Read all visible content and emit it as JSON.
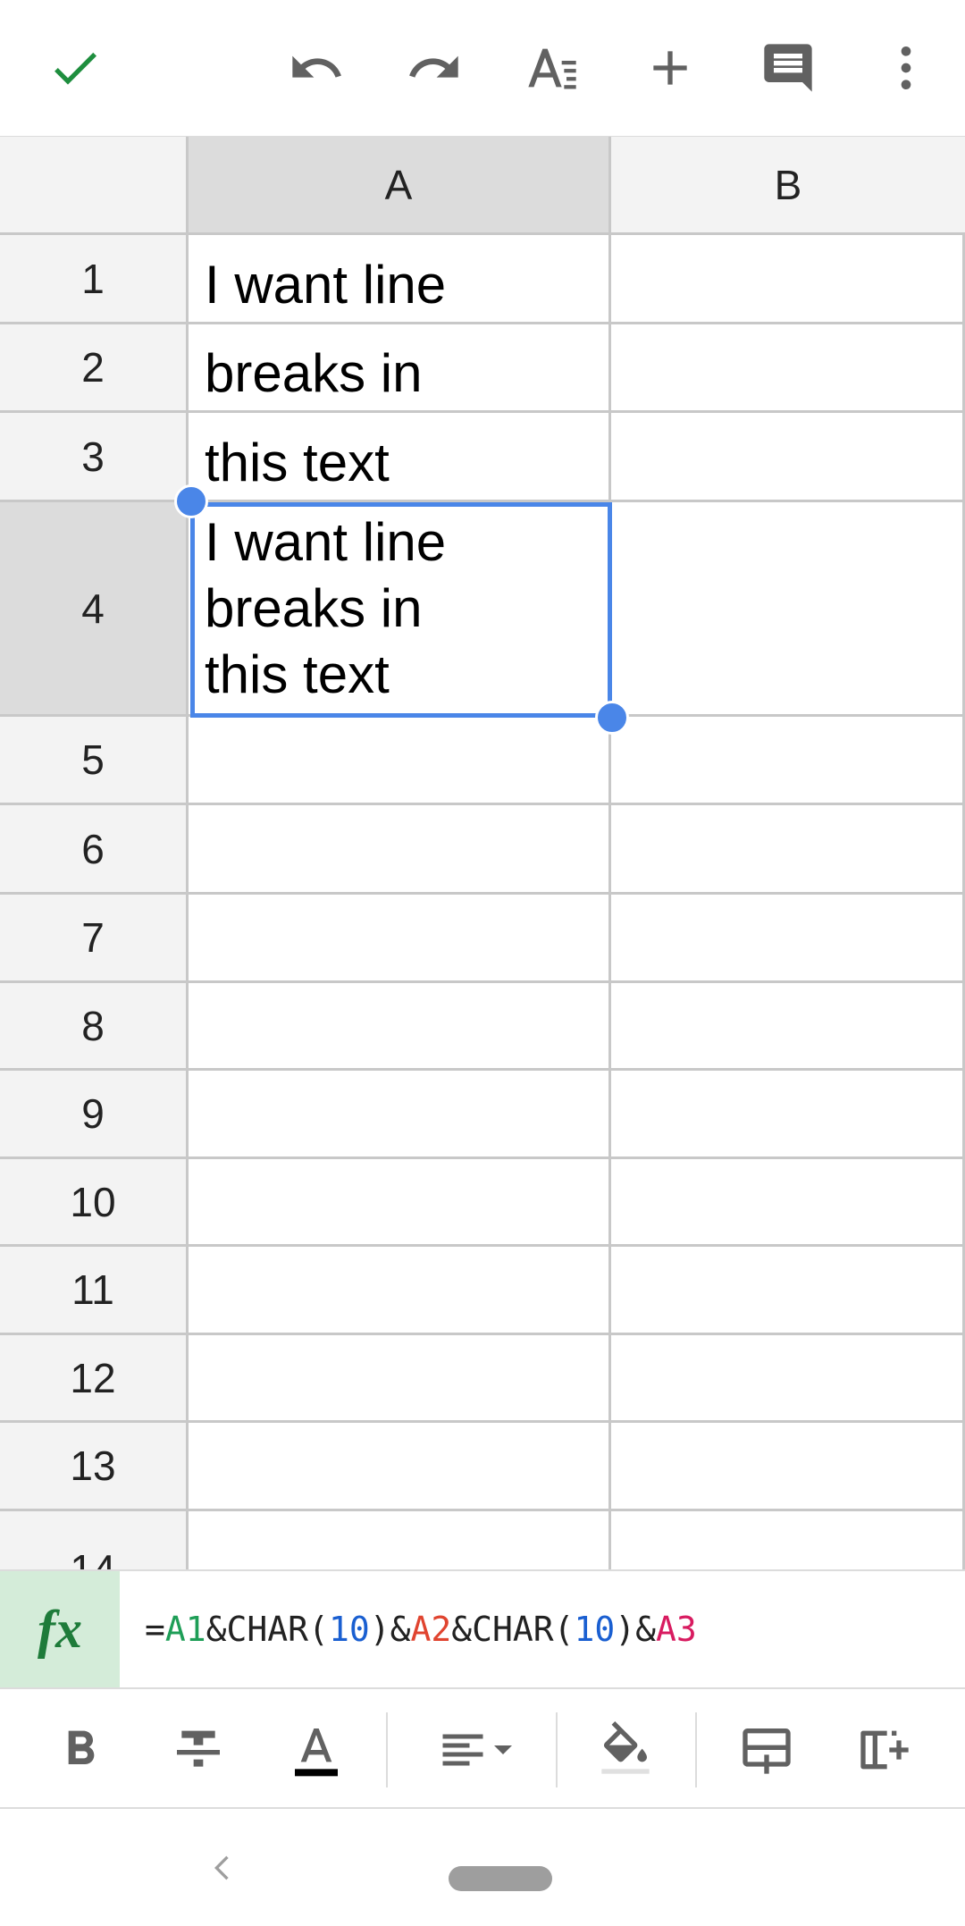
{
  "toolbar": {
    "icons": [
      "check-icon",
      "undo-icon",
      "redo-icon",
      "text-format-icon",
      "insert-icon",
      "comment-icon",
      "more-vert-icon"
    ]
  },
  "columns": [
    "A",
    "B"
  ],
  "rows": [
    "1",
    "2",
    "3",
    "4",
    "5",
    "6",
    "7",
    "8",
    "9",
    "10",
    "11",
    "12",
    "13",
    "14"
  ],
  "cells": {
    "A1": "I want line",
    "A2": "breaks in",
    "A3": "this text",
    "A4": "I want line\nbreaks in\nthis text"
  },
  "selected_cell": "A4",
  "formula_bar": {
    "fx_label": "fx",
    "tokens": [
      {
        "text": "=",
        "color": "#222222"
      },
      {
        "text": "A1",
        "color": "#1e9e57"
      },
      {
        "text": "&CHAR(",
        "color": "#222222"
      },
      {
        "text": "10",
        "color": "#1a5fd1"
      },
      {
        "text": ")&",
        "color": "#222222"
      },
      {
        "text": "A2",
        "color": "#e0442f"
      },
      {
        "text": "&CHAR(",
        "color": "#222222"
      },
      {
        "text": "10",
        "color": "#1a5fd1"
      },
      {
        "text": ")&",
        "color": "#222222"
      },
      {
        "text": "A3",
        "color": "#d81b60"
      }
    ]
  },
  "format_toolbar": {
    "icons": [
      "bold-icon",
      "strikethrough-icon",
      "text-color-icon",
      "align-icon",
      "fill-color-icon",
      "insert-row-icon",
      "insert-column-icon"
    ]
  },
  "colors": {
    "accent": "#4a86e8",
    "check": "#1e8e3e",
    "fx_bg": "#d4ecd9"
  }
}
